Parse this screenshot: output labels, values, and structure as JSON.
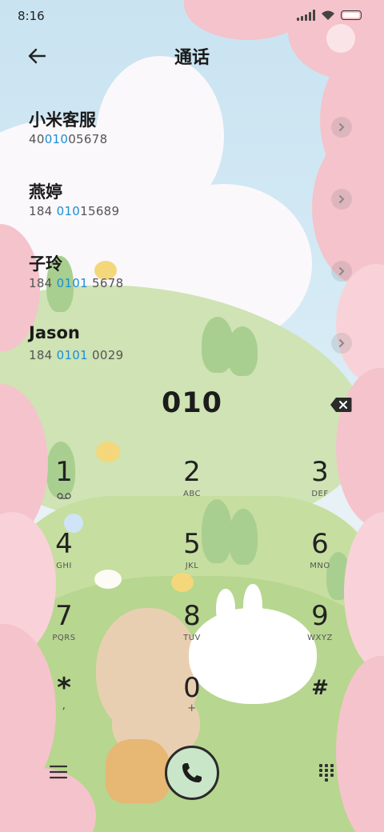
{
  "status_bar": {
    "time": "8:16"
  },
  "header": {
    "title": "通话"
  },
  "contacts": [
    {
      "name": "小米客服",
      "number_parts": [
        "40",
        "010",
        "05678"
      ]
    },
    {
      "name": "燕婷",
      "number_parts": [
        "184 ",
        "010",
        "15689"
      ]
    },
    {
      "name": "子玲",
      "number_parts": [
        "184 ",
        "0101",
        " 5678"
      ]
    },
    {
      "name": "Jason",
      "number_parts": [
        "184 ",
        "0101",
        " 0029"
      ]
    }
  ],
  "dialer": {
    "input": "010",
    "keys": [
      {
        "digit": "1",
        "letters": ""
      },
      {
        "digit": "2",
        "letters": "ABC"
      },
      {
        "digit": "3",
        "letters": "DEF"
      },
      {
        "digit": "4",
        "letters": "GHI"
      },
      {
        "digit": "5",
        "letters": "JKL"
      },
      {
        "digit": "6",
        "letters": "MNO"
      },
      {
        "digit": "7",
        "letters": "PQRS"
      },
      {
        "digit": "8",
        "letters": "TUV"
      },
      {
        "digit": "9",
        "letters": "WXYZ"
      },
      {
        "digit": "*",
        "letters": ","
      },
      {
        "digit": "0",
        "letters": "+"
      },
      {
        "digit": "#",
        "letters": ""
      }
    ]
  },
  "colors": {
    "highlight": "#1a8fd6",
    "call_button": "#c9e6c8"
  },
  "icons": {
    "back": "back-arrow-icon",
    "chevron": "chevron-right-icon",
    "backspace": "backspace-icon",
    "voicemail": "voicemail-icon",
    "menu": "menu-icon",
    "call": "phone-icon",
    "keypad": "keypad-icon"
  }
}
